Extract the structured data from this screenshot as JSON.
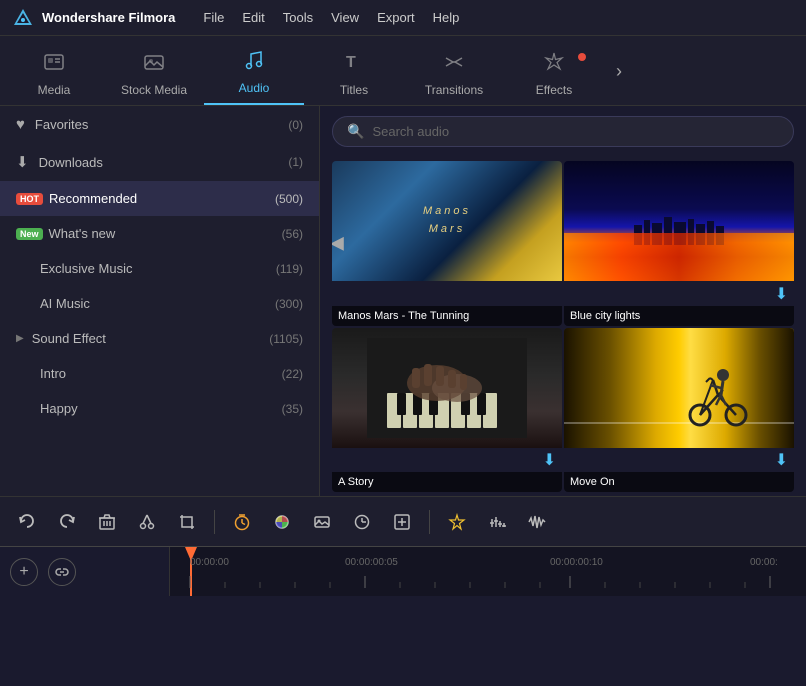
{
  "app": {
    "name": "Wondershare Filmora"
  },
  "menu": {
    "items": [
      "File",
      "Edit",
      "Tools",
      "View",
      "Export",
      "Help"
    ]
  },
  "nav_tabs": [
    {
      "id": "media",
      "label": "Media",
      "icon": "🗂️",
      "active": false
    },
    {
      "id": "stock_media",
      "label": "Stock Media",
      "icon": "🖼️",
      "active": false
    },
    {
      "id": "audio",
      "label": "Audio",
      "icon": "🎵",
      "active": true
    },
    {
      "id": "titles",
      "label": "Titles",
      "icon": "T",
      "active": false
    },
    {
      "id": "transitions",
      "label": "Transitions",
      "icon": "⇄",
      "active": false
    },
    {
      "id": "effects",
      "label": "Effects",
      "icon": "✦",
      "active": false
    }
  ],
  "sidebar": {
    "items": [
      {
        "id": "favorites",
        "label": "Favorites",
        "icon": "♥",
        "count": "(0)",
        "badge": null,
        "sub": false,
        "active": false
      },
      {
        "id": "downloads",
        "label": "Downloads",
        "icon": "⬇",
        "count": "(1)",
        "badge": null,
        "sub": false,
        "active": false
      },
      {
        "id": "recommended",
        "label": "Recommended",
        "icon": null,
        "count": "(500)",
        "badge": "HOT",
        "sub": false,
        "active": true
      },
      {
        "id": "whats_new",
        "label": "What's new",
        "icon": null,
        "count": "(56)",
        "badge": "New",
        "sub": false,
        "active": false
      },
      {
        "id": "exclusive",
        "label": "Exclusive Music",
        "icon": null,
        "count": "(119)",
        "badge": null,
        "sub": true,
        "active": false
      },
      {
        "id": "ai_music",
        "label": "AI Music",
        "icon": null,
        "count": "(300)",
        "badge": null,
        "sub": true,
        "active": false
      },
      {
        "id": "sound_effect",
        "label": "Sound Effect",
        "icon": null,
        "count": "(1105)",
        "badge": null,
        "sub": false,
        "expand": true,
        "active": false
      },
      {
        "id": "intro",
        "label": "Intro",
        "icon": null,
        "count": "(22)",
        "badge": null,
        "sub": true,
        "active": false
      },
      {
        "id": "happy",
        "label": "Happy",
        "icon": null,
        "count": "(35)",
        "badge": null,
        "sub": true,
        "active": false
      }
    ]
  },
  "search": {
    "placeholder": "Search audio"
  },
  "media_items": [
    {
      "id": "manos_mars",
      "title": "Manos Mars - The Tunning",
      "has_download": false
    },
    {
      "id": "blue_city",
      "title": "Blue city lights",
      "has_download": true
    },
    {
      "id": "a_story",
      "title": "A Story",
      "has_download": true
    },
    {
      "id": "move_on",
      "title": "Move On",
      "has_download": true
    }
  ],
  "toolbar": {
    "buttons": [
      "↩",
      "↪",
      "🗑",
      "✂",
      "⊡",
      "⏱",
      "✏",
      "⊡",
      "⏱",
      "⊕",
      "◈",
      "⊟",
      "📊"
    ]
  },
  "timeline": {
    "timestamps": [
      "00:00:00",
      "00:00:00:05",
      "00:00:00:10",
      "00:00:"
    ]
  }
}
